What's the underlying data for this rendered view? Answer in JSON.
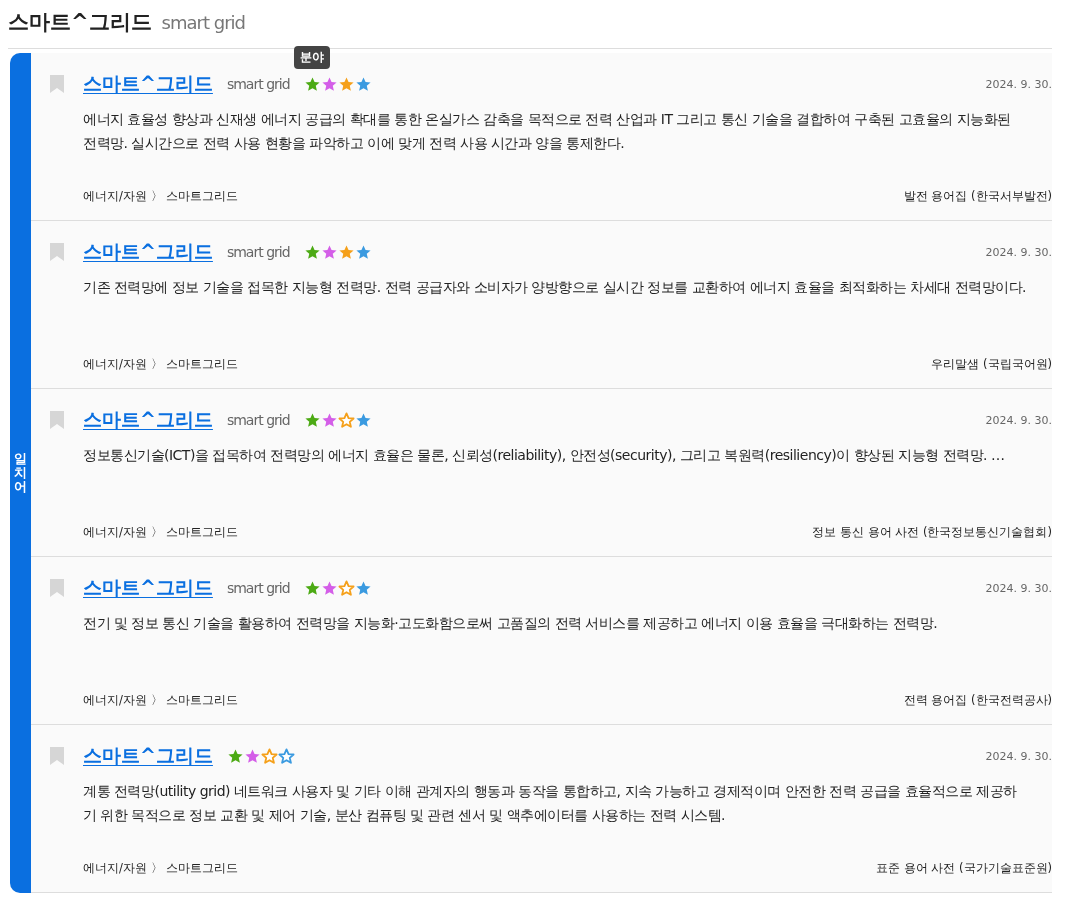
{
  "heading": {
    "title": "스마트^그리드",
    "subtitle": "smart grid"
  },
  "side_label": "일치어",
  "entries": [
    {
      "term": "스마트^그리드",
      "english": "smart grid",
      "tooltip": "분야",
      "ratings": [
        {
          "color": "#4caa14",
          "filled": true
        },
        {
          "color": "#d45ee8",
          "filled": true
        },
        {
          "color": "#f5a01a",
          "filled": true
        },
        {
          "color": "#3a9ae0",
          "filled": true
        }
      ],
      "date": "2024. 9. 30.",
      "definition": "에너지 효율성 향상과 신재생 에너지 공급의 확대를 통한 온실가스 감축을 목적으로 전력 산업과 IT 그리고 통신 기술을 결합하여 구축된 고효율의 지능화된 전력망. 실시간으로 전력 사용 현황을 파악하고 이에 맞게 전력 사용 시간과 양을 통제한다.",
      "category": "에너지/자원 〉 스마트그리드",
      "source": "발전 용어집 (한국서부발전)"
    },
    {
      "term": "스마트^그리드",
      "english": "smart grid",
      "ratings": [
        {
          "color": "#4caa14",
          "filled": true
        },
        {
          "color": "#d45ee8",
          "filled": true
        },
        {
          "color": "#f5a01a",
          "filled": true
        },
        {
          "color": "#3a9ae0",
          "filled": true
        }
      ],
      "date": "2024. 9. 30.",
      "definition": "기존 전력망에 정보 기술을 접목한 지능형 전력망. 전력 공급자와 소비자가 양방향으로 실시간 정보를 교환하여 에너지 효율을 최적화하는 차세대 전력망이다.",
      "category": "에너지/자원 〉 스마트그리드",
      "source": "우리말샘 (국립국어원)"
    },
    {
      "term": "스마트^그리드",
      "english": "smart grid",
      "ratings": [
        {
          "color": "#4caa14",
          "filled": true
        },
        {
          "color": "#d45ee8",
          "filled": true
        },
        {
          "color": "#f5a01a",
          "filled": false
        },
        {
          "color": "#3a9ae0",
          "filled": true
        }
      ],
      "date": "2024. 9. 30.",
      "definition": "정보통신기술(ICT)을 접목하여 전력망의 에너지 효율은 물론, 신뢰성(reliability), 안전성(security), 그리고 복원력(resiliency)이 향상된 지능형 전력망. …",
      "category": "에너지/자원 〉 스마트그리드",
      "source": "정보 통신 용어 사전 (한국정보통신기술협회)"
    },
    {
      "term": "스마트^그리드",
      "english": "smart grid",
      "ratings": [
        {
          "color": "#4caa14",
          "filled": true
        },
        {
          "color": "#d45ee8",
          "filled": true
        },
        {
          "color": "#f5a01a",
          "filled": false
        },
        {
          "color": "#3a9ae0",
          "filled": true
        }
      ],
      "date": "2024. 9. 30.",
      "definition": "전기 및 정보 통신 기술을 활용하여 전력망을 지능화·고도화함으로써 고품질의 전력 서비스를 제공하고 에너지 이용 효율을 극대화하는 전력망.",
      "category": "에너지/자원 〉 스마트그리드",
      "source": "전력 용어집 (한국전력공사)"
    },
    {
      "term": "스마트^그리드",
      "ratings": [
        {
          "color": "#4caa14",
          "filled": true
        },
        {
          "color": "#d45ee8",
          "filled": true
        },
        {
          "color": "#f5a01a",
          "filled": false
        },
        {
          "color": "#3a9ae0",
          "filled": false
        }
      ],
      "date": "2024. 9. 30.",
      "definition": "계통 전력망(utility grid) 네트워크 사용자 및 기타 이해 관계자의 행동과 동작을 통합하고, 지속 가능하고 경제적이며 안전한 전력 공급을 효율적으로 제공하기 위한 목적으로 정보 교환 및 제어 기술, 분산 컴퓨팅 및 관련 센서 및 액추에이터를 사용하는 전력 시스템.",
      "category": "에너지/자원 〉 스마트그리드",
      "source": "표준 용어 사전 (국가기술표준원)"
    }
  ]
}
